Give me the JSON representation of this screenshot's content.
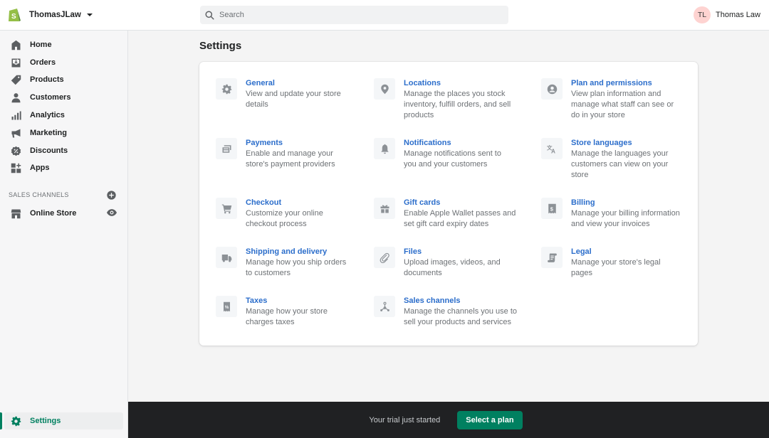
{
  "topbar": {
    "store_name": "ThomasJLaw",
    "search_placeholder": "Search",
    "user_initials": "TL",
    "user_name": "Thomas Law"
  },
  "sidebar": {
    "items": [
      {
        "label": "Home",
        "icon": "home-icon"
      },
      {
        "label": "Orders",
        "icon": "orders-icon"
      },
      {
        "label": "Products",
        "icon": "tag-icon"
      },
      {
        "label": "Customers",
        "icon": "person-icon"
      },
      {
        "label": "Analytics",
        "icon": "bar-chart-icon"
      },
      {
        "label": "Marketing",
        "icon": "megaphone-icon"
      },
      {
        "label": "Discounts",
        "icon": "discount-icon"
      },
      {
        "label": "Apps",
        "icon": "apps-icon"
      }
    ],
    "sales_channels_label": "SALES CHANNELS",
    "online_store_label": "Online Store",
    "settings_label": "Settings"
  },
  "main": {
    "title": "Settings",
    "settings": [
      {
        "title": "General",
        "desc": [
          "View and update your store",
          "details"
        ],
        "icon": "gear-icon"
      },
      {
        "title": "Locations",
        "desc": [
          "Manage the places you stock",
          "inventory, fulfill orders, and sell",
          "products"
        ],
        "icon": "location-pin-icon"
      },
      {
        "title": "Plan and permissions",
        "desc": [
          "View plan information and",
          "manage what staff can see or",
          "do in your store"
        ],
        "icon": "user-circle-icon"
      },
      {
        "title": "Payments",
        "desc": [
          "Enable and manage your",
          "store's payment providers"
        ],
        "icon": "credit-card-icon"
      },
      {
        "title": "Notifications",
        "desc": [
          "Manage notifications sent to",
          "you and your customers"
        ],
        "icon": "bell-icon"
      },
      {
        "title": "Store languages",
        "desc": [
          "Manage the languages your",
          "customers can view on your",
          "store"
        ],
        "icon": "translate-icon"
      },
      {
        "title": "Checkout",
        "desc": [
          "Customize your online",
          "checkout process"
        ],
        "icon": "cart-icon"
      },
      {
        "title": "Gift cards",
        "desc": [
          "Enable Apple Wallet passes and",
          "set gift card expiry dates"
        ],
        "icon": "gift-icon"
      },
      {
        "title": "Billing",
        "desc": [
          "Manage your billing information",
          "and view your invoices"
        ],
        "icon": "dollar-receipt-icon"
      },
      {
        "title": "Shipping and delivery",
        "desc": [
          "Manage how you ship orders",
          "to customers"
        ],
        "icon": "truck-icon"
      },
      {
        "title": "Files",
        "desc": [
          "Upload images, videos, and",
          "documents"
        ],
        "icon": "paperclip-icon"
      },
      {
        "title": "Legal",
        "desc": [
          "Manage your store's legal",
          "pages"
        ],
        "icon": "scroll-icon"
      },
      {
        "title": "Taxes",
        "desc": [
          "Manage how your store",
          "charges taxes"
        ],
        "icon": "tax-receipt-icon"
      },
      {
        "title": "Sales channels",
        "desc": [
          "Manage the channels you use to",
          "sell your products and services"
        ],
        "icon": "channels-icon"
      }
    ]
  },
  "trial": {
    "text": "Your trial just started",
    "button_label": "Select a plan"
  },
  "colors": {
    "brand_green": "#008060",
    "link_blue": "#2c6ecb",
    "avatar_bg": "#fed3d1",
    "trial_bar_bg": "#202123"
  }
}
